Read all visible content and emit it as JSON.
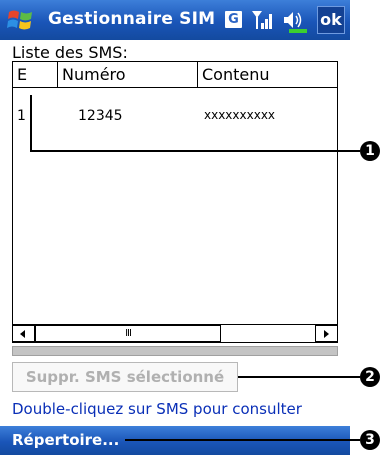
{
  "titlebar": {
    "title": "Gestionnaire SIM",
    "input_mode": "G",
    "ok_label": "ok"
  },
  "list": {
    "caption": "Liste des SMS:",
    "columns": [
      "E",
      "Numéro",
      "Contenu"
    ],
    "rows": [
      {
        "status": "1",
        "number": "12345",
        "content": "xxxxxxxxxx"
      }
    ],
    "scroll_thumb": "III"
  },
  "actions": {
    "delete_label": "Suppr. SMS sélectionné",
    "hint": "Double-cliquez sur SMS pour consulter"
  },
  "menubar": {
    "label": "Répertoire..."
  },
  "callouts": [
    "1",
    "2",
    "3"
  ],
  "colors": {
    "bar_blue": "#1a55b8",
    "hint_blue": "#0a2fb7",
    "disabled_text": "#b0b0b0"
  },
  "icons": [
    "windows-flag-icon",
    "signal-icon",
    "speaker-icon"
  ]
}
